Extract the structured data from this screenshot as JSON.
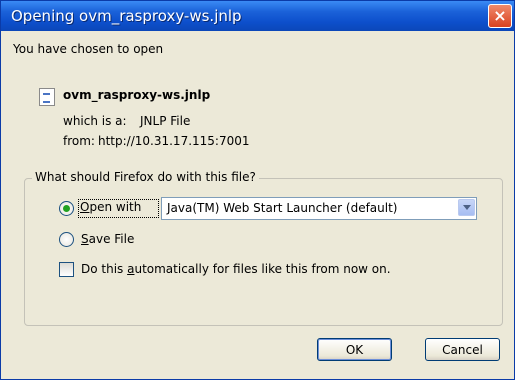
{
  "window": {
    "title": "Opening ovm_rasproxy-ws.jnlp",
    "close_glyph": "×"
  },
  "intro": "You have chosen to open",
  "file": {
    "icon": "jnlp-file-icon",
    "name": "ovm_rasproxy-ws.jnlp",
    "type_label": "which is a:",
    "type_value": "JNLP File",
    "from_label": "from:",
    "from_value": "http://10.31.17.115:7001"
  },
  "action_group": {
    "legend": "What should Firefox do with this file?",
    "open_with": {
      "mnemonic": "O",
      "rest": "pen with",
      "selected": true
    },
    "app_select": {
      "value": "Java(TM) Web Start Launcher (default)"
    },
    "save_file": {
      "mnemonic": "S",
      "rest": "ave File",
      "selected": false
    },
    "auto_checkbox": {
      "before": "Do this ",
      "mnemonic": "a",
      "after": "utomatically for files like this from now on.",
      "checked": false
    }
  },
  "buttons": {
    "ok": "OK",
    "cancel": "Cancel"
  },
  "colors": {
    "titlebar": "#0d4fcc",
    "dialog_bg": "#ece9d8",
    "close_button": "#d9421f",
    "radio_dot": "#21a121"
  }
}
